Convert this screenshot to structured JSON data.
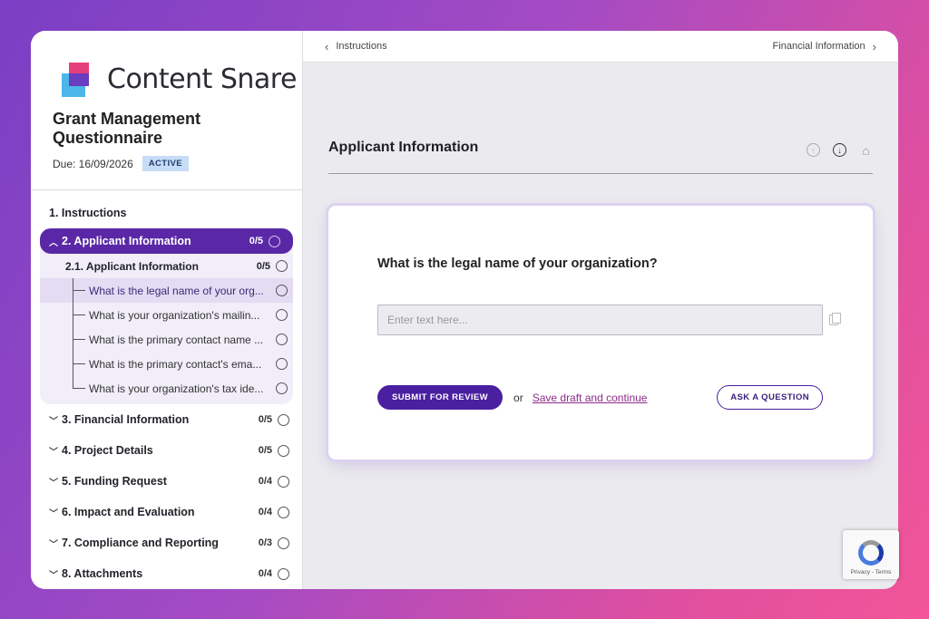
{
  "brand": {
    "name": "Content Snare"
  },
  "questionnaire": {
    "title": "Grant Management Questionnaire",
    "due": "Due: 16/09/2026",
    "status": "ACTIVE"
  },
  "sidebar": {
    "sections": [
      {
        "label": "1. Instructions"
      },
      {
        "label": "2. Applicant Information",
        "count": "0/5"
      },
      {
        "label": "3. Financial Information",
        "count": "0/5"
      },
      {
        "label": "4. Project Details",
        "count": "0/5"
      },
      {
        "label": "5. Funding Request",
        "count": "0/4"
      },
      {
        "label": "6. Impact and Evaluation",
        "count": "0/4"
      },
      {
        "label": "7. Compliance and Reporting",
        "count": "0/3"
      },
      {
        "label": "8. Attachments",
        "count": "0/4"
      }
    ],
    "subsection": {
      "label": "2.1. Applicant Information",
      "count": "0/5"
    },
    "questions": [
      "What is the legal name of your org...",
      "What is your organization's mailin...",
      "What is the primary contact name ...",
      "What is the primary contact's ema...",
      "What is your organization's tax ide..."
    ]
  },
  "topbar": {
    "prev": "Instructions",
    "next": "Financial Information"
  },
  "main": {
    "section_title": "Applicant Information",
    "question": "What is the legal name of your organization?",
    "input_placeholder": "Enter text here...",
    "submit_label": "SUBMIT FOR REVIEW",
    "or_label": "or",
    "save_label": "Save draft and continue",
    "ask_label": "ASK A QUESTION"
  },
  "recaptcha": {
    "text": "Privacy - Terms"
  },
  "colors": {
    "accent": "#5a28a6",
    "link": "#8d2b88"
  }
}
